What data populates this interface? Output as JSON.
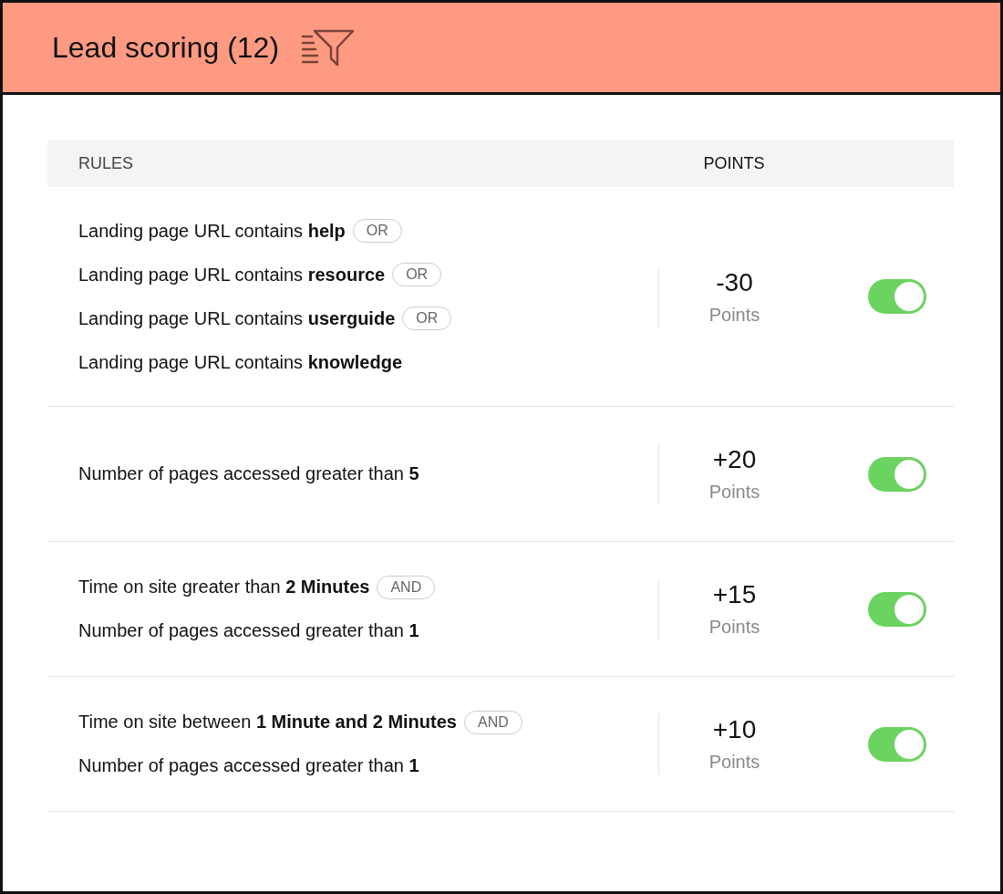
{
  "header": {
    "title": "Lead scoring (12)"
  },
  "table": {
    "columns": [
      "RULES",
      "POINTS"
    ],
    "rows": [
      {
        "conditions": [
          {
            "text": "Landing page URL contains **help**",
            "connector": "OR"
          },
          {
            "text": "Landing page URL contains **resource**",
            "connector": "OR"
          },
          {
            "text": "Landing page URL contains **userguide**",
            "connector": "OR"
          },
          {
            "text": "Landing page URL contains **knowledge**"
          }
        ],
        "points": "-30",
        "unit": "Points",
        "on": true
      },
      {
        "conditions": [
          {
            "text": "Number of pages accessed greater than **5**"
          }
        ],
        "points": "+20",
        "unit": "Points",
        "on": true
      },
      {
        "conditions": [
          {
            "text": "Time on site greater than **2 Minutes**",
            "connector": "AND"
          },
          {
            "text": "Number of pages accessed greater than **1**"
          }
        ],
        "points": "+15",
        "unit": "Points",
        "on": true
      },
      {
        "conditions": [
          {
            "text": "Time on site between **1 Minute and 2 Minutes**",
            "connector": "AND"
          },
          {
            "text": "Number of pages accessed greater than **1**"
          }
        ],
        "points": "+10",
        "unit": "Points",
        "on": true
      }
    ]
  }
}
